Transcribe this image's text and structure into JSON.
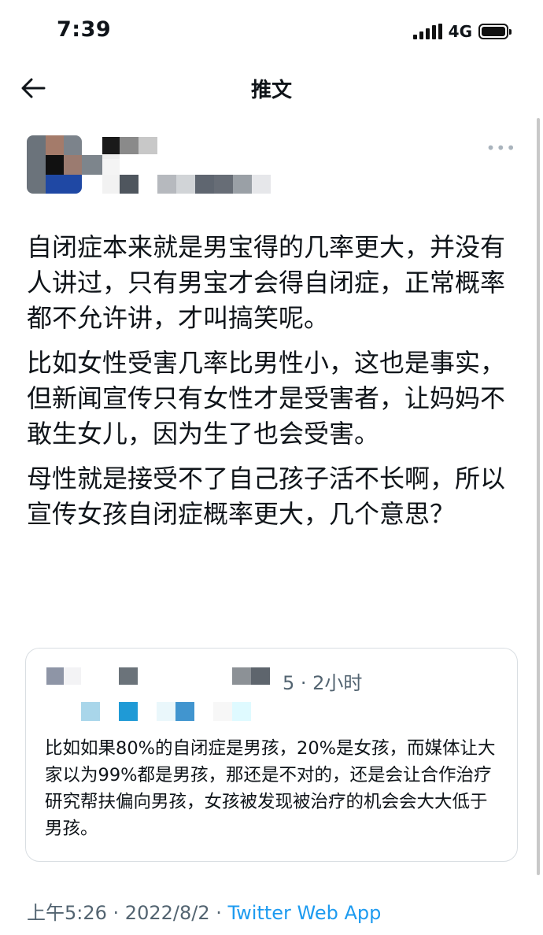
{
  "status_bar": {
    "time": "7:39",
    "network": "4G",
    "icons": [
      "signal-icon",
      "battery-icon"
    ]
  },
  "header": {
    "title": "推文",
    "back_icon": "arrow-left-icon"
  },
  "tweet": {
    "more_icon": "more-horizontal-icon",
    "paragraphs": [
      "自闭症本来就是男宝得的几率更大，并没有人讲过，只有男宝才会得自闭症，正常概率都不允许讲，才叫搞笑呢。",
      "比如女性受害几率比男性小，这也是事实，但新闻宣传只有女性才是受害者，让妈妈不敢生女儿，因为生了也会受害。",
      "母性就是接受不了自己孩子活不长啊，所以宣传女孩自闭症概率更大，几个意思？"
    ],
    "quote": {
      "meta": "5 · 2小时",
      "text": "比如如果80%的自闭症是男孩，20%是女孩，而媒体让大家以为99%都是男孩，那还是不对的，还是会让合作治疗研究帮扶偏向男孩，女孩被发现被治疗的机会会大大低于男孩。"
    },
    "footer": {
      "time": "上午5:26",
      "date": "2022/8/2",
      "separator": " · ",
      "source": "Twitter Web App"
    }
  },
  "colors": {
    "text": "#0f1419",
    "secondary": "#536471",
    "link": "#1d9bf0",
    "border": "#d9dee2"
  }
}
